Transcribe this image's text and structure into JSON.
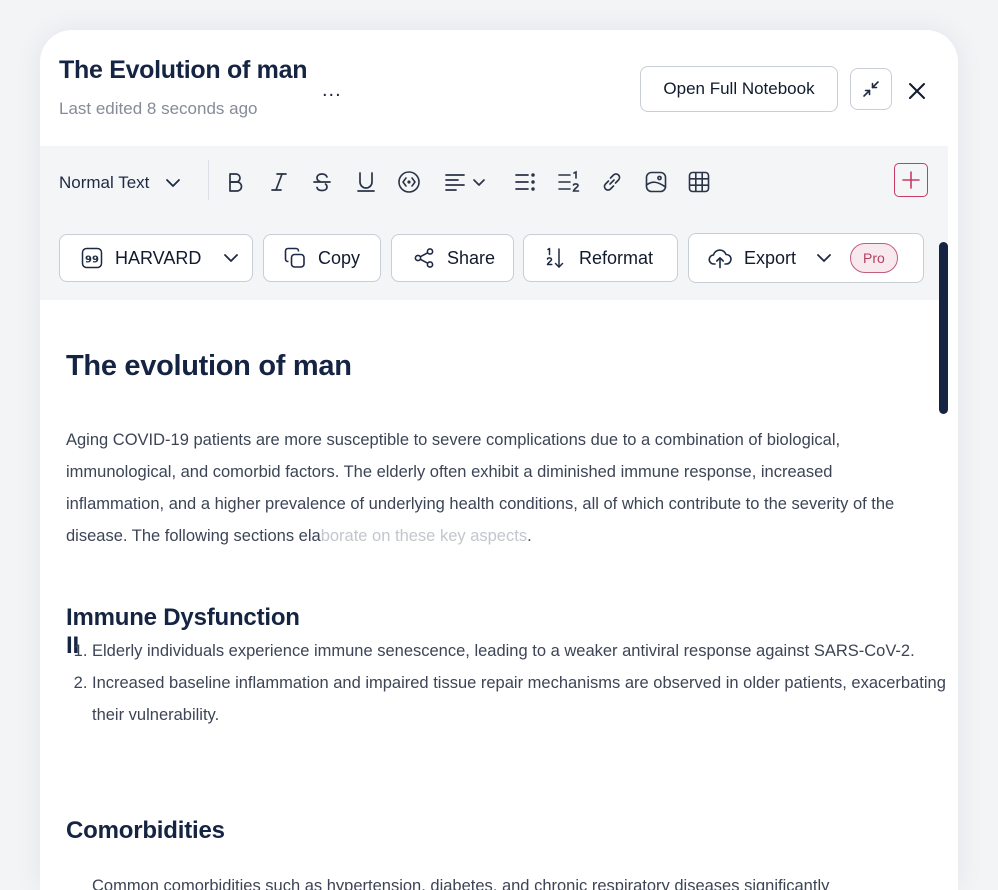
{
  "header": {
    "title": "The Evolution of man",
    "subtitle": "Last edited 8 seconds ago",
    "more": "...",
    "open_full_notebook": "Open Full Notebook"
  },
  "toolbar": {
    "text_style": "Normal Text",
    "actions": {
      "citation_style": "HARVARD",
      "copy": "Copy",
      "share": "Share",
      "reformat": "Reformat",
      "export": "Export",
      "pro_badge": "Pro"
    }
  },
  "document": {
    "heading": "The evolution of man",
    "paragraph_main": "Aging COVID-19 patients are more susceptible to severe complications due to a combination of biological, immunological, and comorbid factors. The elderly often exhibit a diminished immune response, increased inflammation, and a higher prevalence of underlying health conditions, all of which contribute to the severity of the disease. The following sections ela",
    "paragraph_faded": "borate on these key aspects",
    "paragraph_end": ".",
    "section1_title_line1": "Immune Dysfunction",
    "section1_title_line2": "II",
    "section1_items": [
      "Elderly individuals experience immune senescence, leading to a weaker antiviral response against SARS-CoV-2.",
      "Increased baseline inflammation and impaired tissue repair mechanisms are observed in older patients, exacerbating their vulnerability."
    ],
    "section2_title": "Comorbidities",
    "section2_partial": "Common comorbidities such as hypertension, diabetes, and chronic respiratory diseases significantly"
  },
  "colors": {
    "accent": "#c73c63",
    "heading": "#162443",
    "body_text": "#3c4456",
    "toolbar_bg": "#f4f5f7"
  },
  "icons": {
    "more": "ellipsis-icon",
    "collapse": "collapse-arrows-icon",
    "close": "close-icon",
    "bold": "bold-icon",
    "italic": "italic-icon",
    "strike": "strikethrough-icon",
    "underline": "underline-icon",
    "code": "code-icon",
    "align": "align-left-icon",
    "bullet": "bullet-list-icon",
    "numbered": "numbered-list-icon",
    "link": "link-icon",
    "image": "image-icon",
    "table": "table-icon",
    "add": "plus-icon"
  }
}
